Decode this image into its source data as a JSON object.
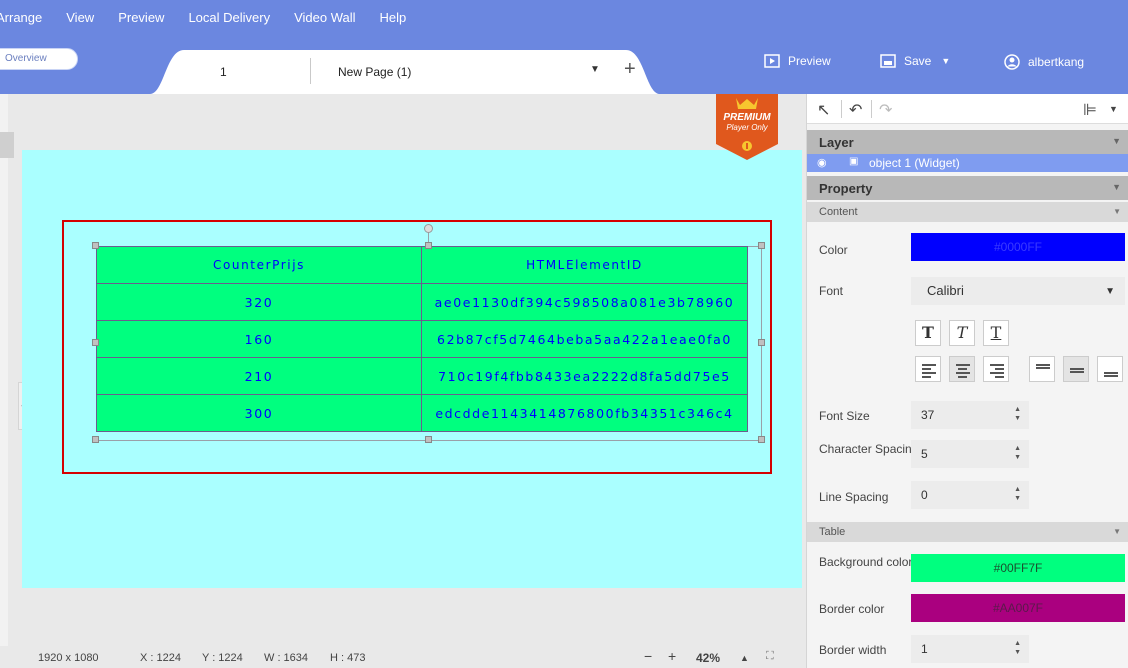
{
  "menu": [
    "Arrange",
    "View",
    "Preview",
    "Local Delivery",
    "Video Wall",
    "Help"
  ],
  "overview_label": "Overview",
  "page_tab": {
    "number": "1",
    "name": "New Page (1)"
  },
  "top_actions": {
    "preview": "Preview",
    "save": "Save",
    "user": "albertkang"
  },
  "premium": {
    "title": "PREMIUM",
    "subtitle": "Player Only"
  },
  "table": {
    "headers": [
      "CounterPrijs",
      "HTMLElementID"
    ],
    "rows": [
      [
        "320",
        "ae0e1130df394c598508a081e3b78960"
      ],
      [
        "160",
        "62b87cf5d7464beba5aa422a1eae0fa0"
      ],
      [
        "210",
        "710c19f4fbb8433ea2222d8fa5dd75e5"
      ],
      [
        "300",
        "edcdde1143414876800fb34351c346c4"
      ]
    ]
  },
  "status": {
    "resolution": "1920 x 1080",
    "x": "X : 1224",
    "y": "Y : 1224",
    "w": "W : 1634",
    "h": "H : 473",
    "zoom": "42%"
  },
  "panel": {
    "layer_title": "Layer",
    "layer_item": "object 1 (Widget)",
    "property_title": "Property",
    "content_title": "Content",
    "color_label": "Color",
    "color_value": "#0000FF",
    "font_label": "Font",
    "font_value": "Calibri",
    "font_size_label": "Font Size",
    "font_size_value": "37",
    "char_spacing_label": "Character Spacing",
    "char_spacing_value": "5",
    "line_spacing_label": "Line Spacing",
    "line_spacing_value": "0",
    "table_title": "Table",
    "bg_color_label": "Background color",
    "bg_color_value": "#00FF7F",
    "border_color_label": "Border color",
    "border_color_value": "#AA007F",
    "border_width_label": "Border width",
    "border_width_value": "1"
  },
  "colors": {
    "menubar": "#6b87e0",
    "stage": "#aaffff",
    "text_color": "#0000ff",
    "table_bg": "#00ff7f",
    "border_color": "#aa007f",
    "selection": "#d40000",
    "layer_highlight": "#7f9cf0"
  }
}
